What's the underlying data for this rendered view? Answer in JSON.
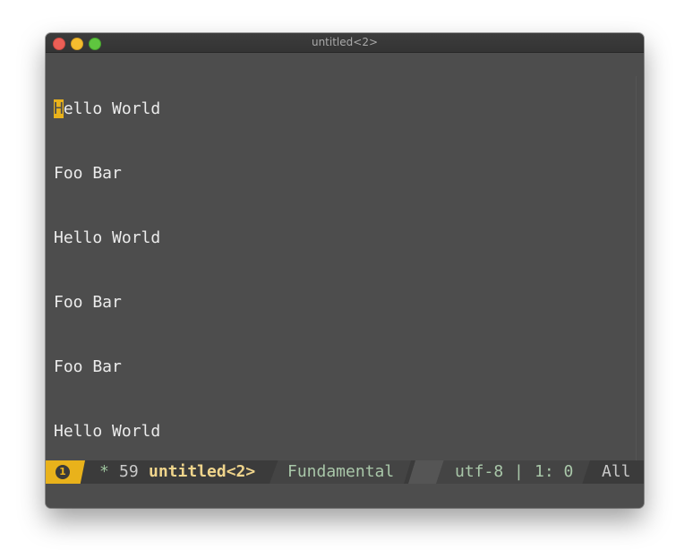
{
  "window": {
    "title": "untitled<2>"
  },
  "buffer": {
    "cursor_char": "H",
    "first_line_rest": "ello World",
    "lines": [
      "Foo Bar",
      "Hello World",
      "Foo Bar",
      "Foo Bar",
      "Hello World"
    ]
  },
  "modeline": {
    "window_number": "1",
    "modified": "*",
    "size": "59",
    "buffer_name": "untitled<2>",
    "major_mode": "Fundamental",
    "encoding": "utf-8",
    "separator": "|",
    "position": "1: 0",
    "scroll": "All"
  },
  "colors": {
    "background": "#4d4d4d",
    "accent": "#e9b21b",
    "text": "#ececec",
    "mode_green": "#a9c7a9"
  },
  "icons": {
    "close": "close-button-icon",
    "minimize": "minimize-button-icon",
    "maximize": "maximize-button-icon"
  }
}
